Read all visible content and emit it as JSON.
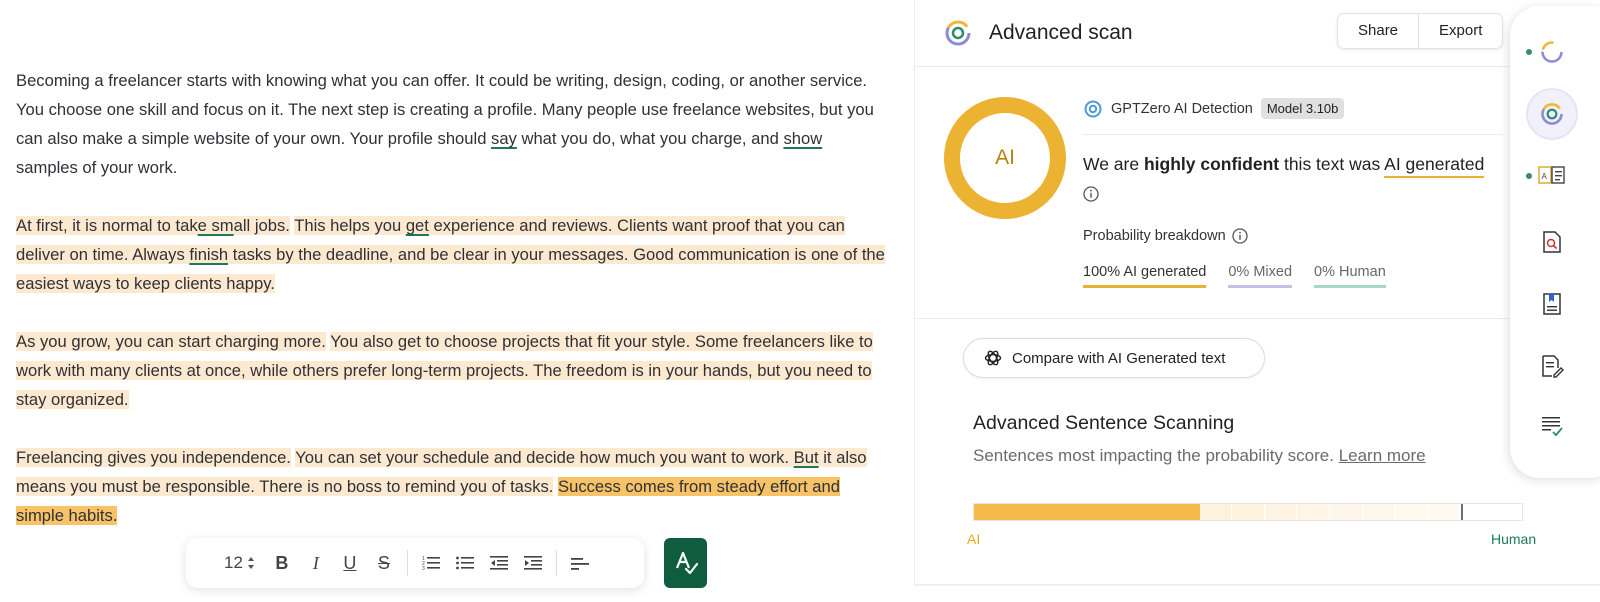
{
  "editor": {
    "paragraphs": [
      [
        {
          "text": "Becoming a freelancer starts with knowing what you can offer. It could be writing, design, coding, or another service. You choose one skill and focus on it. The next step is creating a profile. Many people use freelance websites, but you can also make a simple website of your own. Your profile should "
        },
        {
          "text": "say",
          "u": true
        },
        {
          "text": " what you do, what you charge, and "
        },
        {
          "text": "show",
          "u": true
        },
        {
          "text": " samples of your work."
        }
      ],
      [
        {
          "text": "At first, it is normal to tak",
          "hl": "light"
        },
        {
          "text": "e sm",
          "hl": "light",
          "u": true
        },
        {
          "text": "all jobs.",
          "hl": "light"
        },
        {
          "text": " "
        },
        {
          "text": "This helps you ",
          "hl": "light"
        },
        {
          "text": "get",
          "hl": "light",
          "u": true
        },
        {
          "text": " experience and reviews. Clients want proof that you can deliver on time. Always ",
          "hl": "light"
        },
        {
          "text": "finish",
          "hl": "light",
          "u": true
        },
        {
          "text": " tasks by the deadline, and be clear in your messages. Good communication is one of the easiest ways to keep clients happy.",
          "hl": "light"
        }
      ],
      [
        {
          "text": "As you grow, you can start charging more.",
          "hl": "light"
        },
        {
          "text": " "
        },
        {
          "text": "You also get to choose projects that fit your style. Some freelancers like to work with many clients at once, while others prefer long-term projects. The freedom is in your hands, but you need to stay organized.",
          "hl": "light"
        }
      ],
      [
        {
          "text": "Freelancing gives you independence.",
          "hl": "light"
        },
        {
          "text": " "
        },
        {
          "text": "You can set your schedule and decide how much you want to work. ",
          "hl": "light"
        },
        {
          "text": "But",
          "hl": "light",
          "u": true
        },
        {
          "text": " it also means you must be responsible. There is no boss to remind you of tasks.",
          "hl": "light"
        },
        {
          "text": " "
        },
        {
          "text": "Success comes from steady effort and simple habits.",
          "hl": "strong"
        }
      ]
    ],
    "toolbar": {
      "font_size": "12",
      "bold": "B",
      "italic": "I",
      "underline": "U",
      "strike": "S"
    }
  },
  "scan": {
    "title": "Advanced scan",
    "share_label": "Share",
    "export_label": "Export",
    "gauge_label": "AI",
    "detector_name": "GPTZero AI Detection",
    "model_badge": "Model 3.10b",
    "verdict_prefix": "We are ",
    "verdict_bold": "highly confident",
    "verdict_middle": " this text was ",
    "verdict_result": "AI generated",
    "probability_title": "Probability breakdown",
    "probabilities": {
      "ai": "100% AI generated",
      "mixed": "0% Mixed",
      "human": "0% Human"
    },
    "compare_label": "Compare with AI Generated text",
    "advanced_title": "Advanced Sentence Scanning",
    "advanced_subtitle": "Sentences most impacting the probability score. ",
    "learn_more": "Learn more",
    "scale_ai_label": "AI",
    "scale_human_label": "Human",
    "scale_fill_fraction": 0.41,
    "scale_marker_fraction": 0.885
  },
  "colors": {
    "accent_ai": "#e9b233",
    "human_green": "#1b7d57",
    "highlight_light": "#fde9cf",
    "highlight_strong": "#f8c267",
    "spell_button": "#0f5c3e"
  },
  "rail_icons": [
    "loading-ring-icon",
    "gptzero-logo-icon",
    "ai-vocab-icon",
    "search-document-icon",
    "bookmark-document-icon",
    "edit-document-icon",
    "checklist-icon"
  ]
}
